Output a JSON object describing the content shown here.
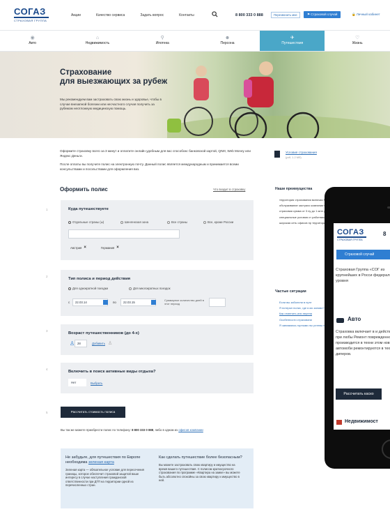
{
  "header": {
    "logo_word": "СОГАЗ",
    "logo_sub": "СТРАХОВАЯ ГРУППА",
    "nav": [
      "Акции",
      "Качество сервиса",
      "Задать вопрос",
      "Контакты"
    ],
    "phone": "8 800 333 0 888",
    "callback": "Перезвонить мне",
    "insured_event": "Страховой случай",
    "cabinet": "Личный кабинет"
  },
  "categories": [
    {
      "label": "Авто",
      "icon": "car-icon",
      "active": false
    },
    {
      "label": "Недвижимость",
      "icon": "house-icon",
      "active": false
    },
    {
      "label": "Ипотека",
      "icon": "key-icon",
      "active": false
    },
    {
      "label": "Персона",
      "icon": "person-icon",
      "active": false
    },
    {
      "label": "Путешествия",
      "icon": "plane-icon",
      "active": true
    },
    {
      "label": "Жизнь",
      "icon": "heart-icon",
      "active": false
    }
  ],
  "hero": {
    "title_1": "Страхование",
    "title_2": "для выезжающих за рубеж",
    "text": "Мы рекомендуем вам застраховать свою жизнь и здоровье, чтобы в случае внезапной болезни или несчастного случая получить за рубежом неотложную медицинскую помощь."
  },
  "intro": {
    "p1": "Оформите страховку всего за 3 минут и оплатите онлайн удобным для вас способом: банковской картой, QIWI, Web Money или Яндекс Деньги.",
    "p2": "После оплаты вы получите полис на электронную почту. Данный полис является международным и принимается всеми консульствами и посольствами для оформления виз."
  },
  "document": {
    "link": "Условия страхования",
    "size": "(pdf, 1.2 Мб)"
  },
  "form": {
    "title": "Оформить полис",
    "what_included": "Что входит в страховку",
    "s1": {
      "num": "1",
      "title": "Куда путешествуете",
      "options": [
        "Отдельные страны (ы)",
        "Шенгенская зона",
        "Все страны",
        "Все, кроме России"
      ],
      "chips": [
        "Австрия",
        "Германия"
      ]
    },
    "s2": {
      "num": "2",
      "title": "Тип полиса и период действия",
      "options": [
        "Для однократной поездки",
        "Для многократных поездок"
      ],
      "from_label": "с",
      "from": "22.03.14",
      "to_label": "по",
      "to": "22.03.15",
      "days_note": "Суммарное количество дней в этот период"
    },
    "s3": {
      "num": "3",
      "title": "Возраст путешественников (до 4-х)",
      "age": "28",
      "add": "Добавить"
    },
    "s4": {
      "num": "4",
      "title": "Включить в поиск активные виды отдыха?",
      "answer": "Нет",
      "choose": "Выбрать"
    },
    "s5": {
      "num": "5"
    },
    "calc_button": "Рассчитать стоимость полиса",
    "phone_note_1": "Вы так же можете приобрести полис по телефону",
    "phone_note_phone": "8 800 333 0 888",
    "phone_note_2": ", либо в одном из",
    "phone_note_link": "офисов компании"
  },
  "info": {
    "left_title": "Не забудьте, для путешествия по Европе необходима",
    "left_link": "зеленая карта",
    "left_text": "Зеленая карта — обязательное условие для пересечения границы, которое обеспечит страховой защитой ваше интересу в случае наступления гражданской ответственности при ДТП на территории одной из перечисленных стран.",
    "right_title": "Как сделать путешествие более безопасным?",
    "right_text": "Вы можете застраховать свою квартиру и имущество на время вашего путешествия. С полисом краткосрочного страхования по программе «Квартира на замке» вы можете быть абсолютно спокойны за свою квартиру и имущество в ней."
  },
  "advantages": {
    "title": "Наши преимущества",
    "items": [
      "территория страхования включая Россию и страны",
      "обслуживание застрахо компании ООО «Кпасс»",
      "страховая сумма от 3 пу до 1 млн у.е.",
      "специальные условия ст работников ОАО «ГАЗПР корпоративных клиентов",
      "широкая сеть офисов пр территории России"
    ]
  },
  "situations": {
    "title": "Частые ситуации",
    "items": [
      "Если вы заболели в путе",
      "Я потерял полис, где я мо заново?",
      "Как отменить или перена",
      "Особенности страховани",
      "Я занимаюсь горными лы учтены на случай что-то"
    ]
  },
  "mobile": {
    "logo_word": "СОГАЗ",
    "logo_sub": "СТРАХОВАЯ ГРУППА",
    "phone": "8",
    "button": "Страховой случай",
    "text": "Страховая Группа «СОГ из крупнейших в Росси федерального уровня",
    "auto": "Авто",
    "auto_text": "Страховка включает в и действует при любы Ремонт поврежденно производится в техни этом новые автомоби ремонтируются в техн диперов.",
    "calc": "Рассчитать каско",
    "property": "Недвижимост"
  },
  "colors": {
    "accent": "#4aa7c8",
    "brand": "#1b4a8c",
    "button": "#2f7ed2",
    "dark": "#1e2a3a"
  }
}
